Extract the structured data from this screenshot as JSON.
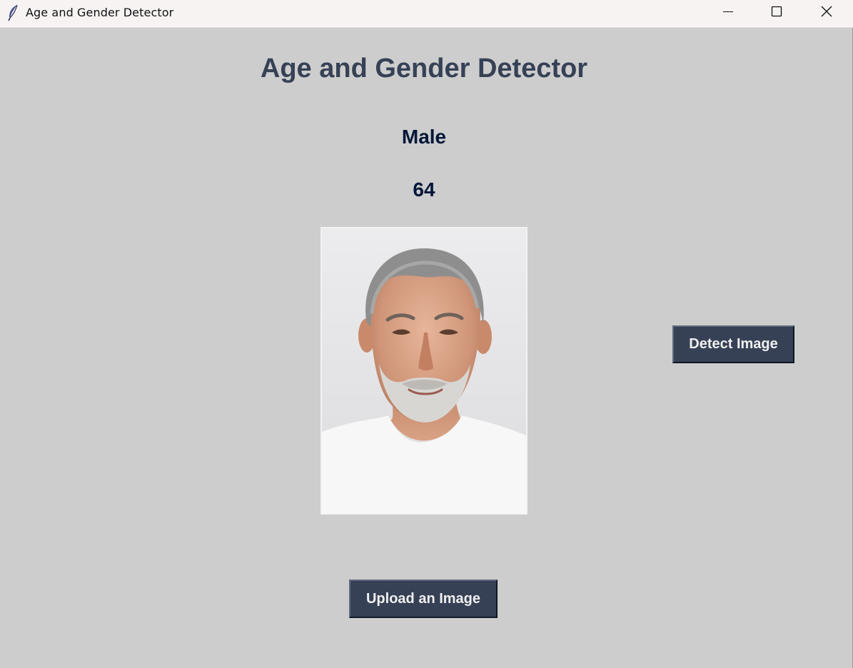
{
  "window": {
    "title": "Age and Gender Detector",
    "controls": [
      "minimize-icon",
      "maximize-icon",
      "close-icon"
    ]
  },
  "main": {
    "heading": "Age and Gender Detector",
    "gender_label": "Male",
    "age_label": "64",
    "image": {
      "description_icon": "portrait-photo"
    },
    "detect_button": "Detect Image",
    "upload_button": "Upload an Image"
  },
  "colors": {
    "background": "#cdcdcd",
    "heading": "#364156",
    "result_text": "#011638",
    "button_bg": "#364156",
    "button_text": "#f0f0f0"
  }
}
